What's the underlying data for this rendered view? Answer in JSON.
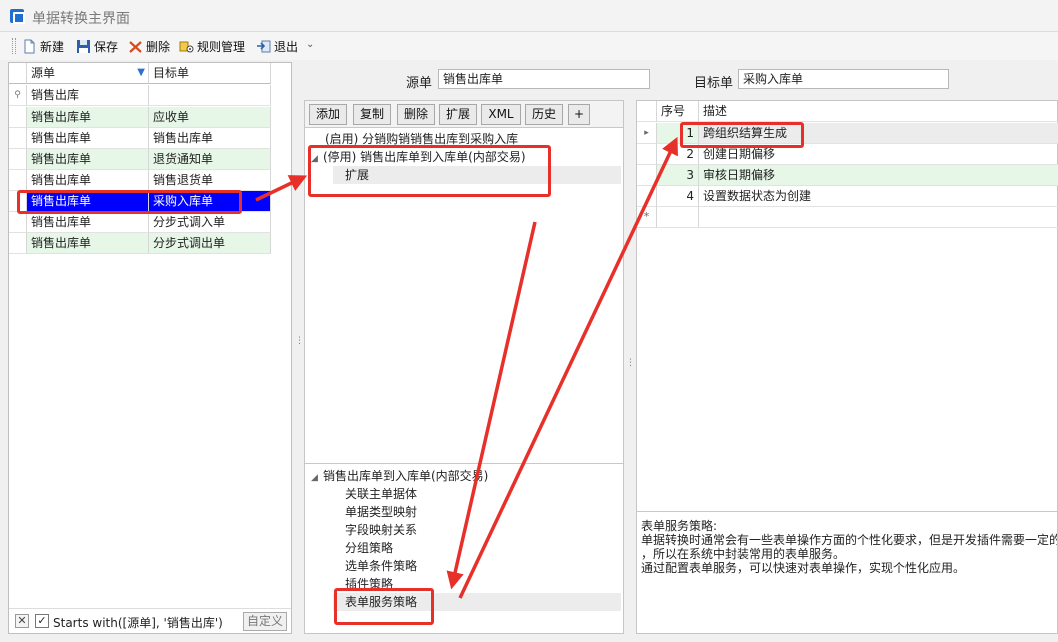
{
  "window": {
    "title": "单据转换主界面"
  },
  "toolbar": {
    "new_label": "新建",
    "save_label": "保存",
    "delete_label": "删除",
    "rules_label": "规则管理",
    "exit_label": "退出"
  },
  "left_grid": {
    "headers": [
      "源单",
      "目标单"
    ],
    "filter_row": "销售出库",
    "rows": [
      {
        "source": "销售出库单",
        "target": "应收单"
      },
      {
        "source": "销售出库单",
        "target": "销售出库单"
      },
      {
        "source": "销售出库单",
        "target": "退货通知单"
      },
      {
        "source": "销售出库单",
        "target": "销售退货单"
      },
      {
        "source": "销售出库单",
        "target": "采购入库单"
      },
      {
        "source": "销售出库单",
        "target": "分步式调入单"
      },
      {
        "source": "销售出库单",
        "target": "分步式调出单"
      }
    ],
    "selected_index": 4,
    "filter_text": "Starts with([源单], '销售出库')",
    "customize_label": "自定义"
  },
  "header_fields": {
    "source_label": "源单",
    "source_value": "销售出库单",
    "target_label": "目标单",
    "target_value": "采购入库单"
  },
  "mid_buttons": [
    "添加",
    "复制",
    "删除",
    "扩展",
    "XML",
    "历史",
    "+"
  ],
  "rule_tree": {
    "items": [
      "(启用) 分销购销销售出库到采购入库",
      "(停用) 销售出库单到入库单(内部交易)",
      "扩展"
    ]
  },
  "policy_tree": {
    "root": "销售出库单到入库单(内部交易)",
    "children": [
      "关联主单据体",
      "单据类型映射",
      "字段映射关系",
      "分组策略",
      "选单条件策略",
      "插件策略",
      "表单服务策略"
    ]
  },
  "service_grid": {
    "headers": [
      "序号",
      "描述"
    ],
    "rows": [
      {
        "seq": "1",
        "desc": "跨组织结算生成"
      },
      {
        "seq": "2",
        "desc": "创建日期偏移"
      },
      {
        "seq": "3",
        "desc": "审核日期偏移"
      },
      {
        "seq": "4",
        "desc": "设置数据状态为创建"
      }
    ],
    "new_row_marker": "*"
  },
  "description": {
    "lines": [
      "表单服务策略:",
      "单据转换时通常会有一些表单操作方面的个性化要求，但是开发插件需要一定的",
      "，所以在系统中封装常用的表单服务。",
      "通过配置表单服务，可以快速对表单操作，实现个性化应用。"
    ]
  },
  "colors": {
    "annotation_red": "#e8302a",
    "selection_blue": "#0000ff",
    "row_green": "#e6f7e8"
  }
}
